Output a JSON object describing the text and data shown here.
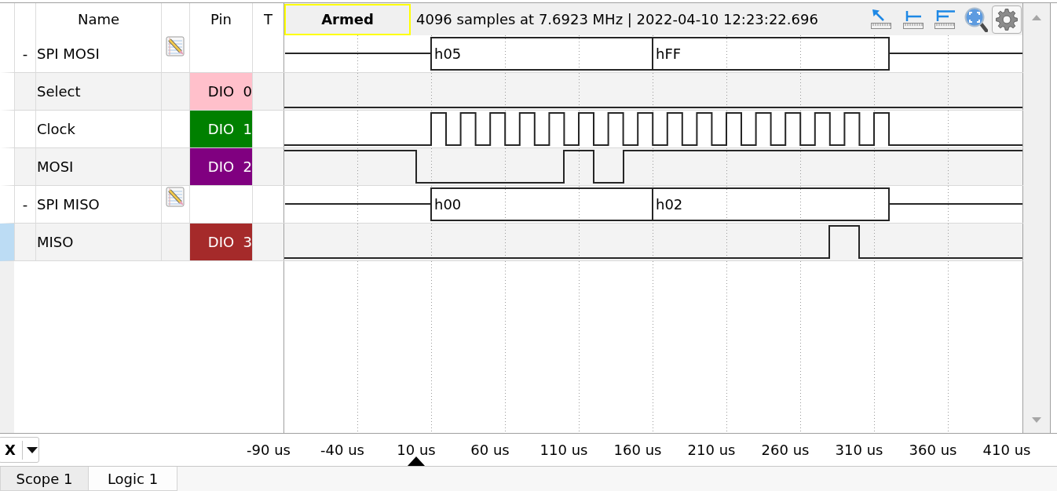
{
  "columns": [
    {
      "label": "Name"
    },
    {
      "label": "Pin"
    },
    {
      "label": "T"
    }
  ],
  "status": {
    "label": "Armed"
  },
  "info": "4096 samples at 7.6923 MHz | 2022-04-10 12:23:22.696",
  "rows": [
    {
      "kind": "bus",
      "toggle": "-",
      "name": "SPI MOSI",
      "selected": false,
      "segments": [
        "h05",
        "hFF"
      ]
    },
    {
      "kind": "signal",
      "name": "Select",
      "pin": "DIO  0",
      "color": "#ffc0cb",
      "selected": false
    },
    {
      "kind": "signal",
      "name": "Clock",
      "pin": "DIO  1",
      "color": "#008000",
      "selected": false
    },
    {
      "kind": "signal",
      "name": "MOSI",
      "pin": "DIO  2",
      "color": "#800080",
      "selected": false
    },
    {
      "kind": "bus",
      "toggle": "-",
      "name": "SPI MISO",
      "selected": false,
      "segments": [
        "h00",
        "h02"
      ]
    },
    {
      "kind": "signal",
      "name": "MISO",
      "pin": "DIO  3",
      "color": "#a52a2a",
      "selected": true
    }
  ],
  "x_axis": {
    "channel": "X",
    "labels": [
      "-90 us",
      "-40 us",
      "10 us",
      "60 us",
      "110 us",
      "160 us",
      "210 us",
      "260 us",
      "310 us",
      "360 us",
      "410 us"
    ]
  },
  "tabs": [
    {
      "label": "Scope 1",
      "selected": false
    },
    {
      "label": "Logic 1",
      "selected": true
    }
  ]
}
